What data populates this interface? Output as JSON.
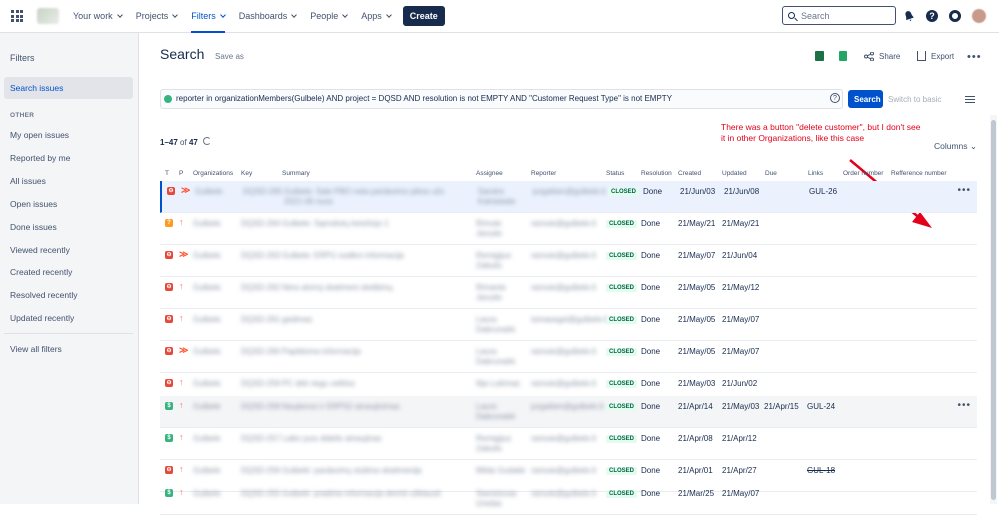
{
  "nav": {
    "items": [
      "Your work",
      "Projects",
      "Filters",
      "Dashboards",
      "People",
      "Apps"
    ],
    "create": "Create",
    "search_placeholder": "Search",
    "help": "?"
  },
  "sidebar": {
    "title": "Filters",
    "active": "Search issues",
    "section": "OTHER",
    "items": [
      "My open issues",
      "Reported by me",
      "All issues",
      "Open issues",
      "Done issues",
      "Viewed recently",
      "Created recently",
      "Resolved recently",
      "Updated recently"
    ],
    "view_all": "View all filters"
  },
  "header": {
    "title": "Search",
    "save_as": "Save as",
    "share": "Share",
    "export": "Export",
    "more": "•••"
  },
  "jql": {
    "query": "reporter in organizationMembers(Gulbele) AND project = DQSD AND resolution is not EMPTY AND \"Customer Request Type\" is not EMPTY",
    "help": "?",
    "search_button": "Search",
    "switch_basic": "Switch to basic"
  },
  "results": {
    "range": "1–47",
    "of": "of",
    "total": "47",
    "columns": "Columns"
  },
  "annotation": {
    "text": "There was a button \"delete customer\", but I don't see it in other Organizations, like this case"
  },
  "table": {
    "headers": [
      "T",
      "P",
      "Organizations",
      "Key",
      "Summary",
      "Assignee",
      "Reporter",
      "Status",
      "Resolution",
      "Created",
      "Updated",
      "Due",
      "Links",
      "Order number",
      "Refference number"
    ],
    "rows": [
      {
        "type": "red",
        "type_icon": "⊖",
        "priority": "high",
        "priority_glyph": "≫",
        "org": "Gulbele",
        "key": "DQSD-265",
        "summary": "Gulbele: Sale PBO neta pardavimo pikos užs 2021-06 nuos",
        "assignee": "Sandra Kalniataite",
        "reporter": "jurgaitien@gulbele.lt",
        "status": "CLOSED",
        "resolution": "Done",
        "created": "21/Jun/03",
        "updated": "21/Jun/08",
        "due": "",
        "links": "GUL-26",
        "links_strike": false,
        "more": true,
        "selected": true
      },
      {
        "type": "orange",
        "type_icon": "?",
        "priority": "up",
        "priority_glyph": "↑",
        "org": "Gulbele",
        "key": "DQSD-264",
        "summary": "Gulbele: Sąmokslų keisčiojo 1",
        "assignee": "Rimute Januite",
        "reporter": "ramute@gulbele.lt",
        "status": "CLOSED",
        "resolution": "Done",
        "created": "21/May/21",
        "updated": "21/May/21",
        "due": "",
        "links": "",
        "links_strike": false,
        "more": false,
        "selected": false
      },
      {
        "type": "red",
        "type_icon": "⊖",
        "priority": "high",
        "priority_glyph": "≫",
        "org": "Gulbele",
        "key": "DQSD-263",
        "summary": "Gulbele: ERPU sodikvi informacija",
        "assignee": "Remigijus Zabulis",
        "reporter": "ramute@gulbele.lt",
        "status": "CLOSED",
        "resolution": "Done",
        "created": "21/May/07",
        "updated": "21/Jun/04",
        "due": "",
        "links": "",
        "links_strike": false,
        "more": false,
        "selected": false
      },
      {
        "type": "red",
        "type_icon": "⊖",
        "priority": "up",
        "priority_glyph": "↑",
        "org": "Gulbele",
        "key": "DQSD-262",
        "summary": "Nėra atviroj skaitmeni skelbimų",
        "assignee": "Rimante Januite",
        "reporter": "ramute@gulbele.lt",
        "status": "CLOSED",
        "resolution": "Done",
        "created": "21/May/05",
        "updated": "21/May/12",
        "due": "",
        "links": "",
        "links_strike": false,
        "more": false,
        "selected": false
      },
      {
        "type": "red",
        "type_icon": "⊖",
        "priority": "up",
        "priority_glyph": "↑",
        "org": "Gulbele",
        "key": "DQSD-261",
        "summary": "gedimas",
        "assignee": "Laura Dabrunaitė",
        "reporter": "tomasegel@gulbele.lt",
        "status": "CLOSED",
        "resolution": "Done",
        "created": "21/May/05",
        "updated": "21/May/07",
        "due": "",
        "links": "",
        "links_strike": false,
        "more": false,
        "selected": false
      },
      {
        "type": "red",
        "type_icon": "⊖",
        "priority": "high",
        "priority_glyph": "≫",
        "org": "Gulbele",
        "key": "DQSD-260",
        "summary": "Papildoma informacija",
        "assignee": "Laura Dabrunaitė",
        "reporter": "ramute@gulbele.lt",
        "status": "CLOSED",
        "resolution": "Done",
        "created": "21/May/05",
        "updated": "21/May/07",
        "due": "",
        "links": "",
        "links_strike": false,
        "more": false,
        "selected": false
      },
      {
        "type": "red",
        "type_icon": "⊖",
        "priority": "up",
        "priority_glyph": "↑",
        "org": "Gulbele",
        "key": "DQSD-259",
        "summary": "PC diėt negu veiklos",
        "assignee": "Ilija Lukimas",
        "reporter": "ramute@gulbele.lt",
        "status": "CLOSED",
        "resolution": "Done",
        "created": "21/May/03",
        "updated": "21/Jun/02",
        "due": "",
        "links": "",
        "links_strike": false,
        "more": false,
        "selected": false
      },
      {
        "type": "green",
        "type_icon": "$",
        "priority": "up",
        "priority_glyph": "↑",
        "org": "Gulbele",
        "key": "DQSD-258",
        "summary": "Naujienos ir ERPS2 atnaujinimas",
        "assignee": "Laura Dabrunaitė",
        "reporter": "jurgaitien@gulbele.lt",
        "status": "CLOSED",
        "resolution": "Done",
        "created": "21/Apr/14",
        "updated": "21/May/03",
        "due": "21/Apr/15",
        "links": "GUL-24",
        "links_strike": false,
        "more": true,
        "selected": false,
        "grey": true
      },
      {
        "type": "green",
        "type_icon": "$",
        "priority": "up",
        "priority_glyph": "↑",
        "org": "Gulbele",
        "key": "DQSD-257",
        "summary": "Laiko juos didelis atnaujinas",
        "assignee": "Remigijus Zabulis",
        "reporter": "ramute@gulbele.lt",
        "status": "CLOSED",
        "resolution": "Done",
        "created": "21/Apr/08",
        "updated": "21/Apr/12",
        "due": "",
        "links": "",
        "links_strike": false,
        "more": false,
        "selected": false
      },
      {
        "type": "red",
        "type_icon": "⊖",
        "priority": "up",
        "priority_glyph": "↑",
        "org": "Gulbele",
        "key": "DQSD-256",
        "summary": "Gulbelė: pardavimų stubina skaitmenija",
        "assignee": "Milda Gudaitė",
        "reporter": "ramute@gulbele.lt",
        "status": "CLOSED",
        "resolution": "Done",
        "created": "21/Apr/01",
        "updated": "21/Apr/27",
        "due": "",
        "links": "GUL-18",
        "links_strike": true,
        "more": false,
        "selected": false
      },
      {
        "type": "green",
        "type_icon": "$",
        "priority": "up",
        "priority_glyph": "↑",
        "org": "Gulbele",
        "key": "DQSD-255",
        "summary": "Gulbelė: pradinia informacija derinti užklausti",
        "assignee": "Stanislovas Uredas",
        "reporter": "ramute@gulbele.lt",
        "status": "CLOSED",
        "resolution": "Done",
        "created": "21/Mar/25",
        "updated": "21/May/07",
        "due": "",
        "links": "",
        "links_strike": false,
        "more": false,
        "selected": false
      }
    ]
  }
}
